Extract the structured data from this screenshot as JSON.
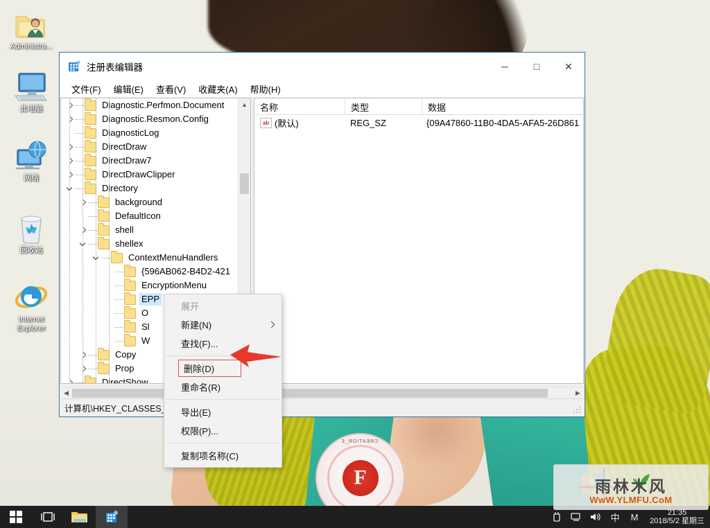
{
  "desktop": {
    "icons": [
      {
        "label": "Administra...",
        "icon": "user-folder-icon"
      },
      {
        "label": "此电脑",
        "icon": "this-pc-icon"
      },
      {
        "label": "网络",
        "icon": "network-icon"
      },
      {
        "label": "回收站",
        "icon": "recycle-bin-icon"
      },
      {
        "label": "Internet\nExplorer",
        "icon": "internet-explorer-icon"
      }
    ]
  },
  "window": {
    "title": "注册表编辑器",
    "icon": "registry-editor-icon",
    "buttons": {
      "minimize": "─",
      "maximize": "□",
      "close": "✕"
    },
    "menubar": [
      {
        "label": "文件(F)",
        "name": "menu-file"
      },
      {
        "label": "编辑(E)",
        "name": "menu-edit"
      },
      {
        "label": "查看(V)",
        "name": "menu-view"
      },
      {
        "label": "收藏夹(A)",
        "name": "menu-favorites"
      },
      {
        "label": "帮助(H)",
        "name": "menu-help"
      }
    ],
    "statusbar": "计算机\\HKEY_CLASSES_RO                              tMenuHandlers\\EPP"
  },
  "tree": {
    "items": [
      {
        "label": "Diagnostic.Perfmon.Document",
        "indent": 1,
        "expander": "collapsed",
        "selected": false
      },
      {
        "label": "Diagnostic.Resmon.Config",
        "indent": 1,
        "expander": "collapsed",
        "selected": false
      },
      {
        "label": "DiagnosticLog",
        "indent": 1,
        "expander": "none",
        "selected": false
      },
      {
        "label": "DirectDraw",
        "indent": 1,
        "expander": "collapsed",
        "selected": false
      },
      {
        "label": "DirectDraw7",
        "indent": 1,
        "expander": "collapsed",
        "selected": false
      },
      {
        "label": "DirectDrawClipper",
        "indent": 1,
        "expander": "collapsed",
        "selected": false
      },
      {
        "label": "Directory",
        "indent": 1,
        "expander": "expanded",
        "selected": false
      },
      {
        "label": "background",
        "indent": 2,
        "expander": "collapsed",
        "selected": false
      },
      {
        "label": "DefaultIcon",
        "indent": 2,
        "expander": "none",
        "selected": false
      },
      {
        "label": "shell",
        "indent": 2,
        "expander": "collapsed",
        "selected": false
      },
      {
        "label": "shellex",
        "indent": 2,
        "expander": "expanded",
        "selected": false
      },
      {
        "label": "ContextMenuHandlers",
        "indent": 3,
        "expander": "expanded",
        "selected": false
      },
      {
        "label": "{596AB062-B4D2-421",
        "indent": 4,
        "expander": "none",
        "selected": false
      },
      {
        "label": "EncryptionMenu",
        "indent": 4,
        "expander": "none",
        "selected": false
      },
      {
        "label": "EPP",
        "indent": 4,
        "expander": "none",
        "selected": true
      },
      {
        "label": "O",
        "indent": 4,
        "expander": "none",
        "selected": false
      },
      {
        "label": "Sl",
        "indent": 4,
        "expander": "none",
        "selected": false
      },
      {
        "label": "W",
        "indent": 4,
        "expander": "none",
        "selected": false
      },
      {
        "label": "Copy",
        "indent": 2,
        "expander": "collapsed",
        "selected": false
      },
      {
        "label": "Prop",
        "indent": 2,
        "expander": "collapsed",
        "selected": false
      },
      {
        "label": "DirectShow",
        "indent": 1,
        "expander": "collapsed",
        "selected": false
      }
    ]
  },
  "list": {
    "columns": [
      "名称",
      "类型",
      "数据"
    ],
    "rows": [
      {
        "name": "(默认)",
        "type": "REG_SZ",
        "data": "{09A47860-11B0-4DA5-AFA5-26D861",
        "icon": "ab-string-icon"
      }
    ]
  },
  "context_menu": {
    "items": [
      {
        "label": "展开",
        "name": "ctx-expand",
        "disabled": true,
        "submenu": false,
        "highlighted": false
      },
      {
        "label": "新建(N)",
        "name": "ctx-new",
        "disabled": false,
        "submenu": true,
        "highlighted": false
      },
      {
        "label": "查找(F)...",
        "name": "ctx-find",
        "disabled": false,
        "submenu": false,
        "highlighted": false
      },
      {
        "separator": true
      },
      {
        "label": "删除(D)",
        "name": "ctx-delete",
        "disabled": false,
        "submenu": false,
        "highlighted": true
      },
      {
        "label": "重命名(R)",
        "name": "ctx-rename",
        "disabled": false,
        "submenu": false,
        "highlighted": false
      },
      {
        "separator": true
      },
      {
        "label": "导出(E)",
        "name": "ctx-export",
        "disabled": false,
        "submenu": false,
        "highlighted": false
      },
      {
        "label": "权限(P)...",
        "name": "ctx-permissions",
        "disabled": false,
        "submenu": false,
        "highlighted": false
      },
      {
        "separator": true
      },
      {
        "label": "复制项名称(C)",
        "name": "ctx-copy-key-name",
        "disabled": false,
        "submenu": false,
        "highlighted": false
      }
    ],
    "highlight_color": "#d9534f",
    "annotation_arrow_color": "#e8372b"
  },
  "taskbar": {
    "buttons": [
      {
        "name": "start-button",
        "icon": "windows-logo-icon"
      },
      {
        "name": "task-view-button",
        "icon": "task-view-icon"
      },
      {
        "name": "file-explorer-button",
        "icon": "folder-icon"
      },
      {
        "name": "registry-editor-taskbar-button",
        "icon": "registry-editor-icon",
        "active": true
      }
    ],
    "tray": [
      {
        "name": "usb-icon",
        "glyph": "usb"
      },
      {
        "name": "network-icon",
        "glyph": "network"
      },
      {
        "name": "volume-icon",
        "glyph": "volume"
      },
      {
        "name": "ime-icon",
        "glyph": "中"
      },
      {
        "name": "ime-mode-icon",
        "glyph": "M"
      }
    ],
    "clock": {
      "time": "21:35",
      "date": "2018/5/2 星期三"
    }
  },
  "watermark": {
    "brand": "雨林木风",
    "url": "WwW.YLMFU.CoM",
    "accent": "#d4541a"
  }
}
